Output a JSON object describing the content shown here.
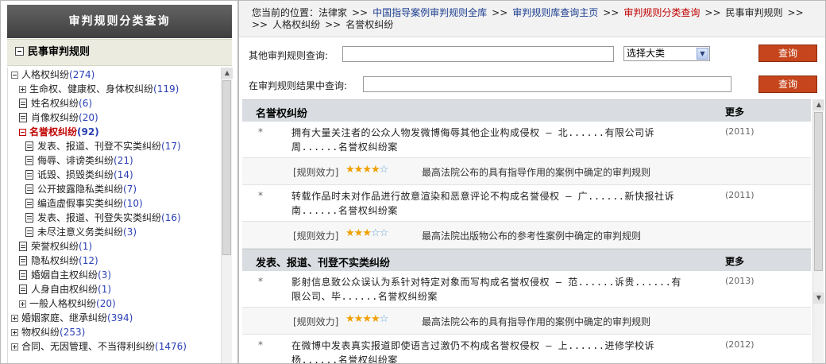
{
  "sidebar": {
    "title": "审判规则分类查询",
    "root_label": "民事审判规则",
    "tree": [
      {
        "label": "人格权纠纷",
        "count": "(274)",
        "icon": "collapse"
      },
      {
        "label": "生命权、健康权、身体权纠纷",
        "count": "(119)",
        "icon": "expand"
      },
      {
        "label": "姓名权纠纷",
        "count": "(6)",
        "icon": "doc"
      },
      {
        "label": "肖像权纠纷",
        "count": "(20)",
        "icon": "doc"
      },
      {
        "label": "名誉权纠纷",
        "count": "(92)",
        "icon": "collapse-selected"
      },
      {
        "label": "发表、报道、刊登不实类纠纷",
        "count": "(17)",
        "icon": "doc"
      },
      {
        "label": "侮辱、诽谤类纠纷",
        "count": "(21)",
        "icon": "doc"
      },
      {
        "label": "诋毁、损毁类纠纷",
        "count": "(14)",
        "icon": "doc"
      },
      {
        "label": "公开披露隐私类纠纷",
        "count": "(7)",
        "icon": "doc"
      },
      {
        "label": "编造虚假事实类纠纷",
        "count": "(10)",
        "icon": "doc"
      },
      {
        "label": "发表、报道、刊登失实类纠纷",
        "count": "(16)",
        "icon": "doc"
      },
      {
        "label": "未尽注意义务类纠纷",
        "count": "(3)",
        "icon": "doc"
      },
      {
        "label": "荣誉权纠纷",
        "count": "(1)",
        "icon": "doc"
      },
      {
        "label": "隐私权纠纷",
        "count": "(12)",
        "icon": "doc"
      },
      {
        "label": "婚姻自主权纠纷",
        "count": "(3)",
        "icon": "doc"
      },
      {
        "label": "人身自由权纠纷",
        "count": "(1)",
        "icon": "doc"
      },
      {
        "label": "一般人格权纠纷",
        "count": "(20)",
        "icon": "expand"
      },
      {
        "label": "婚姻家庭、继承纠纷",
        "count": "(394)",
        "icon": "expand"
      },
      {
        "label": "物权纠纷",
        "count": "(253)",
        "icon": "expand"
      },
      {
        "label": "合同、无因管理、不当得利纠纷",
        "count": "(1476)",
        "icon": "expand"
      }
    ]
  },
  "breadcrumb": {
    "prefix": "您当前的位置：",
    "items": [
      "法律家",
      "中国指导案例审判规则全库",
      "审判规则库查询主页",
      "审判规则分类查询",
      "民事审判规则",
      "人格权纠纷",
      "名誉权纠纷"
    ],
    "separator": ">>"
  },
  "search": {
    "other_label": "其他审判规则查询:",
    "other_value": "",
    "category_select": "选择大类",
    "button_label": "查询",
    "within_label": "在审判规则结果中查询:",
    "within_value": ""
  },
  "results": {
    "more_label": "更多",
    "effect_label": "[规则效力]",
    "sections": [
      {
        "title": "名誉权纠纷",
        "items": [
          {
            "title_line1": "拥有大量关注者的公众人物发微博侮辱其他企业构成侵权  – 北......有限公司诉",
            "title_line2": "周......名誉权纠纷案",
            "year": "(2011)",
            "stars": 4,
            "desc": "最高法院公布的具有指导作用的案例中确定的审判规则"
          },
          {
            "title_line1": "转载作品时未对作品进行故意渲染和恶意评论不构成名誉侵权  – 广......新快报社诉",
            "title_line2": "南......名誉权纠纷案",
            "year": "(2011)",
            "stars": 3,
            "desc": "最高法院出版物公布的参考性案例中确定的审判规则"
          }
        ]
      },
      {
        "title": "发表、报道、刊登不实类纠纷",
        "items": [
          {
            "title_line1": "影射信息致公众误认为系针对特定对象而写构成名誉权侵权  – 范......诉贵......有",
            "title_line2": "限公司、毕......名誉权纠纷案",
            "year": "(2013)",
            "stars": 4,
            "desc": "最高法院公布的具有指导作用的案例中确定的审判规则"
          },
          {
            "title_line1": "在微博中发表真实报道即使语言过激仍不构成名誉权侵权  – 上......进修学校诉",
            "title_line2": "杨......名誉权纠纷案",
            "year": "(2012)",
            "stars": 0,
            "desc": ""
          }
        ]
      }
    ]
  },
  "colors": {
    "header_bg": "#4f4f4f",
    "link": "#1a3c8f",
    "current": "#c00000",
    "count": "#2a3fb3",
    "button": "#c6451c",
    "star_filled": "#f0a000",
    "star_empty": "#6aa7d8"
  }
}
